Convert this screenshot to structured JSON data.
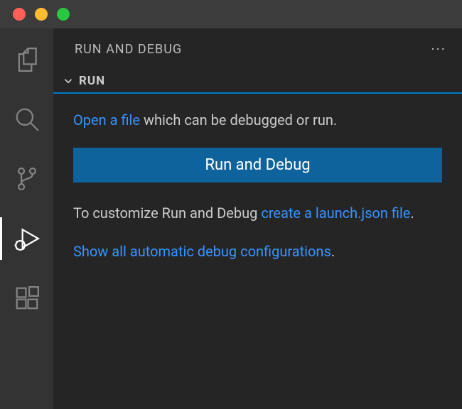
{
  "sidebar": {
    "title": "RUN AND DEBUG",
    "sectionTitle": "RUN"
  },
  "content": {
    "openFileLink": "Open a file",
    "openFileRest": " which can be debugged or run.",
    "runDebugButton": "Run and Debug",
    "customizePrefix": "To customize Run and Debug ",
    "createLaunchLink": "create a launch.json file",
    "customizeSuffix": ".",
    "showAllLink": "Show all automatic debug configurations",
    "showAllSuffix": "."
  }
}
